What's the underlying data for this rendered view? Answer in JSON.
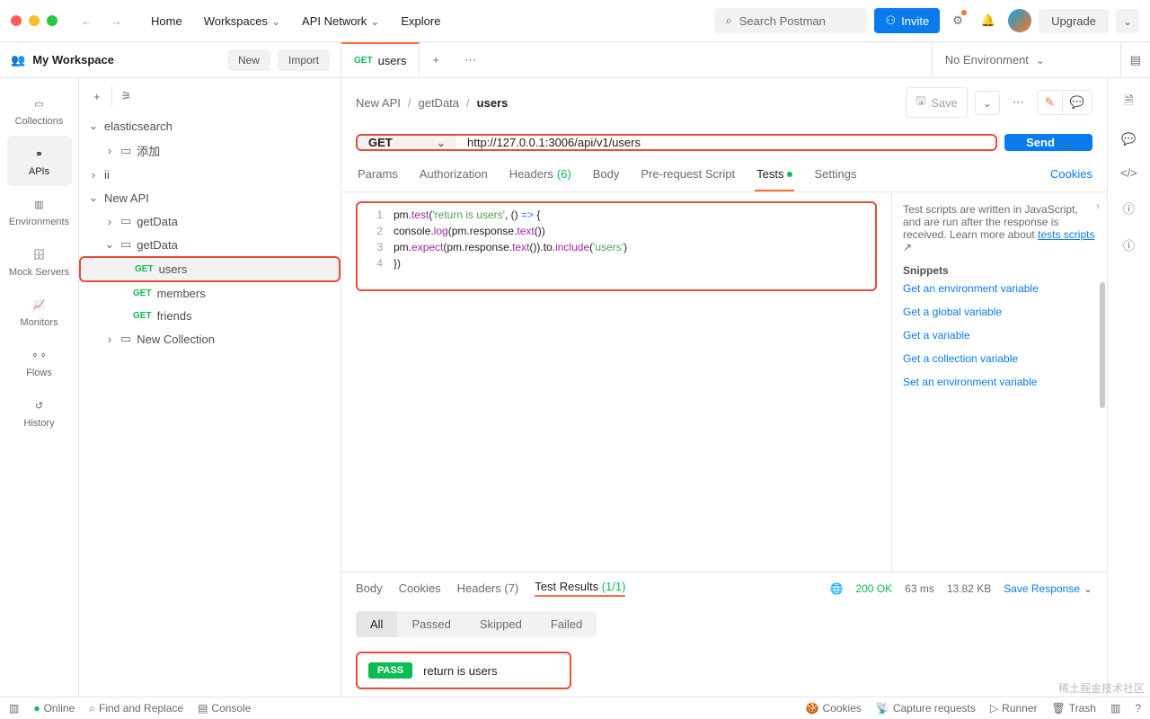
{
  "topnav": {
    "home": "Home",
    "workspaces": "Workspaces",
    "api_network": "API Network",
    "explore": "Explore",
    "search_placeholder": "Search Postman",
    "invite": "Invite",
    "upgrade": "Upgrade"
  },
  "workspace": {
    "name": "My Workspace",
    "new_btn": "New",
    "import_btn": "Import"
  },
  "tab": {
    "method": "GET",
    "title": "users"
  },
  "env": {
    "selected": "No Environment"
  },
  "rail": {
    "collections": "Collections",
    "apis": "APIs",
    "environments": "Environments",
    "mock": "Mock Servers",
    "monitors": "Monitors",
    "flows": "Flows",
    "history": "History"
  },
  "tree": {
    "n0": "elasticsearch",
    "n0_0": "添加",
    "n1": "ii",
    "n2": "New API",
    "n2_0": "getData",
    "n2_1": "getData",
    "n2_1_0": {
      "m": "GET",
      "t": "users"
    },
    "n2_1_1": {
      "m": "GET",
      "t": "members"
    },
    "n2_1_2": {
      "m": "GET",
      "t": "friends"
    },
    "n2_2": "New Collection"
  },
  "breadcrumb": {
    "a": "New API",
    "b": "getData",
    "c": "users",
    "save": "Save"
  },
  "request": {
    "method": "GET",
    "url": "http://127.0.0.1:3006/api/v1/users",
    "send": "Send"
  },
  "reqtabs": {
    "params": "Params",
    "auth": "Authorization",
    "headers": "Headers",
    "headers_n": "(6)",
    "body": "Body",
    "prereq": "Pre-request Script",
    "tests": "Tests",
    "settings": "Settings",
    "cookies": "Cookies"
  },
  "code": {
    "l1a": "pm.",
    "l1b": "test",
    "l1c": "(",
    "l1d": "'return is users'",
    "l1e": ", () ",
    "l1f": "=>",
    "l1g": " {",
    "l2a": "    console.",
    "l2b": "log",
    "l2c": "(pm.response.",
    "l2d": "text",
    "l2e": "())",
    "l3a": "    pm.",
    "l3b": "expect",
    "l3c": "(pm.response.",
    "l3d": "text",
    "l3e": "()).to.",
    "l3f": "include",
    "l3g": "(",
    "l3h": "'users'",
    "l3i": ")",
    "l4": "})"
  },
  "info": {
    "text": "Test scripts are written in JavaScript, and are run after the response is received. Learn more about",
    "link": "tests scripts",
    "snippets_h": "Snippets",
    "s1": "Get an environment variable",
    "s2": "Get a global variable",
    "s3": "Get a variable",
    "s4": "Get a collection variable",
    "s5": "Set an environment variable"
  },
  "resp": {
    "body": "Body",
    "cookies": "Cookies",
    "headers": "Headers",
    "headers_n": "(7)",
    "testres": "Test Results",
    "testres_n": "(1/1)",
    "status": "200 OK",
    "time": "63 ms",
    "size": "13.82 KB",
    "save": "Save Response"
  },
  "filters": {
    "all": "All",
    "passed": "Passed",
    "skipped": "Skipped",
    "failed": "Failed"
  },
  "result": {
    "badge": "PASS",
    "name": "return is users"
  },
  "statusbar": {
    "online": "Online",
    "find": "Find and Replace",
    "console": "Console",
    "cookies": "Cookies",
    "capture": "Capture requests",
    "runner": "Runner",
    "trash": "Trash"
  },
  "watermark": "稀土掘金技术社区"
}
